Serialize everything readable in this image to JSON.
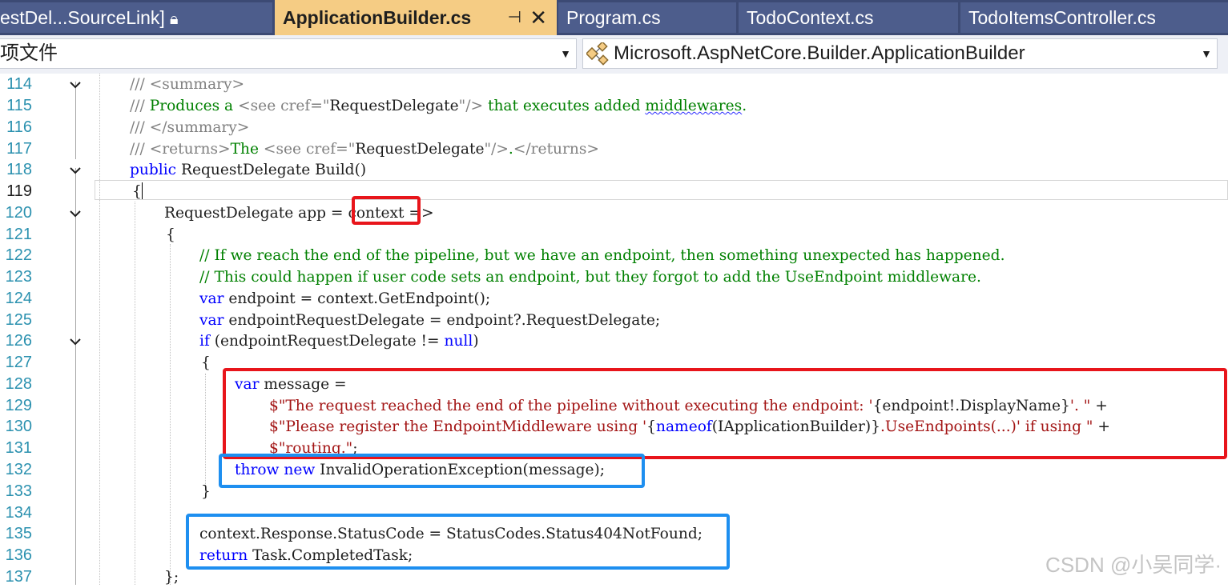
{
  "tabs": [
    {
      "label": "estDel...SourceLink]",
      "locked": true
    },
    {
      "label": "ApplicationBuilder.cs",
      "active": true
    },
    {
      "label": "Program.cs"
    },
    {
      "label": "TodoContext.cs"
    },
    {
      "label": "TodoItemsController.cs"
    }
  ],
  "nav": {
    "project_combo": "项文件",
    "type_combo": "Microsoft.AspNetCore.Builder.ApplicationBuilder"
  },
  "line_numbers": [
    "114",
    "115",
    "116",
    "117",
    "118",
    "119",
    "120",
    "121",
    "122",
    "123",
    "124",
    "125",
    "126",
    "127",
    "128",
    "129",
    "130",
    "131",
    "132",
    "133",
    "134",
    "135",
    "136",
    "137"
  ],
  "code": {
    "l114": {
      "a": "/// <summary>"
    },
    "l115": {
      "a": "/// ",
      "b": "Produces a ",
      "c": "<see cref=\"",
      "d": "RequestDelegate",
      "e": "\"/>",
      "f": " that executes added ",
      "g": "middlewares",
      "h": "."
    },
    "l116": {
      "a": "/// </summary>"
    },
    "l117": {
      "a": "/// <returns>",
      "b": "The ",
      "c": "<see cref=\"",
      "d": "RequestDelegate",
      "e": "\"/>",
      "f": ".",
      "g": "</returns>"
    },
    "l118": {
      "kw": "public",
      "rest": " RequestDelegate Build()"
    },
    "l119": {
      "a": "{"
    },
    "l120": {
      "a": "RequestDelegate app = ",
      "b": "context",
      "c": " =>"
    },
    "l121": {
      "a": "{"
    },
    "l122": {
      "a": "// If we reach the end of the pipeline, but we have an endpoint, then something unexpected has happened."
    },
    "l123": {
      "a": "// This could happen if user code sets an endpoint, but they forgot to add the UseEndpoint middleware."
    },
    "l124": {
      "kw": "var",
      "rest": " endpoint = context.GetEndpoint();"
    },
    "l125": {
      "kw": "var",
      "rest": " endpointRequestDelegate = endpoint?.RequestDelegate;"
    },
    "l126": {
      "kw": "if",
      "a": " (endpointRequestDelegate != ",
      "kw2": "null",
      "b": ")"
    },
    "l127": {
      "a": "{"
    },
    "l128": {
      "kw": "var",
      "rest": " message ="
    },
    "l129": {
      "s1": "$\"The request reached the end of the pipeline without executing the endpoint: '",
      "i1": "{endpoint!.DisplayName}",
      "s2": "'. \"",
      "p": " +"
    },
    "l130": {
      "s1": "$\"Please register the EndpointMiddleware using '",
      "b1": "{",
      "kw": "nameof",
      "i1": "(IApplicationBuilder)}",
      "s2": ".UseEndpoints(...)' if using \"",
      "p": " +"
    },
    "l131": {
      "s1": "$\"routing.\"",
      "p": ";"
    },
    "l132": {
      "kw": "throw",
      "kw2": " new",
      "rest": " InvalidOperationException(message);"
    },
    "l133": {
      "a": "}"
    },
    "l135": {
      "a": "context.Response.StatusCode = StatusCodes.Status404NotFound;"
    },
    "l136": {
      "kw": "return",
      "rest": " Task.CompletedTask;"
    },
    "l137": {
      "a": "};"
    }
  },
  "watermark": "CSDN @小吴同学·",
  "colors": {
    "keyword": "#0000ff",
    "comment": "#008000",
    "doc_tag": "#808080",
    "string": "#a31515",
    "line_number": "#2b91af",
    "annotation_red": "#e8151b",
    "annotation_blue": "#1e8ff0",
    "active_tab": "#f5cc84",
    "tab_bar": "#3c4a74"
  }
}
